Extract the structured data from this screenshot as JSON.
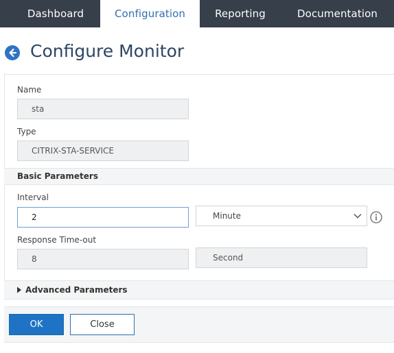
{
  "nav": {
    "tabs": [
      {
        "label": "Dashboard",
        "active": false
      },
      {
        "label": "Configuration",
        "active": true
      },
      {
        "label": "Reporting",
        "active": false
      },
      {
        "label": "Documentation",
        "active": false
      }
    ]
  },
  "page": {
    "title": "Configure Monitor",
    "back_icon": "arrow-left-circle-icon"
  },
  "form": {
    "name_label": "Name",
    "name_value": "sta",
    "type_label": "Type",
    "type_value": "CITRIX-STA-SERVICE",
    "basic_section_title": "Basic Parameters",
    "interval_label": "Interval",
    "interval_value": "2",
    "interval_unit_selected": "Minute",
    "response_timeout_label": "Response Time-out",
    "response_timeout_value": "8",
    "response_timeout_unit": "Second",
    "advanced_section_title": "Advanced Parameters"
  },
  "actions": {
    "ok_label": "OK",
    "close_label": "Close"
  },
  "colors": {
    "nav_background": "#363f4a",
    "active_tab_text": "#2f6eb3",
    "primary_button": "#1f73c4",
    "title_text": "#2d4663"
  }
}
